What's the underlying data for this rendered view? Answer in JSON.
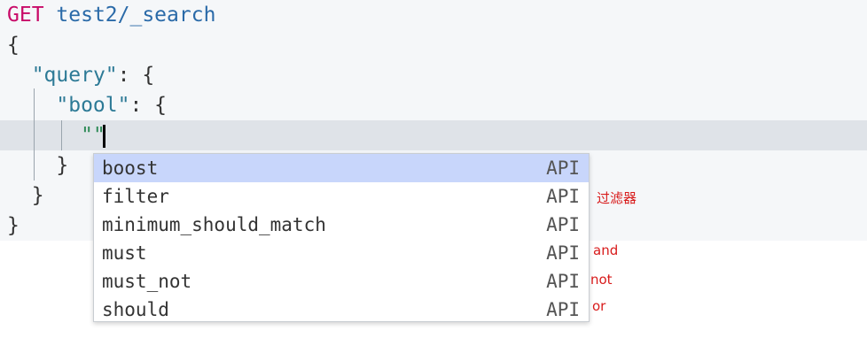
{
  "editor": {
    "method": "GET",
    "path": "test2/_search",
    "open_brace": "{",
    "query_key": "\"query\"",
    "query_rest": ": {",
    "bool_key": "\"bool\"",
    "bool_rest": ": {",
    "typed": "\"\"",
    "close_bool": "}",
    "close_query": "}",
    "close_root": "}"
  },
  "autocomplete": {
    "items": [
      {
        "label": "boost",
        "meta": "API",
        "selected": true
      },
      {
        "label": "filter",
        "meta": "API"
      },
      {
        "label": "minimum_should_match",
        "meta": "API"
      },
      {
        "label": "must",
        "meta": "API"
      },
      {
        "label": "must_not",
        "meta": "API"
      },
      {
        "label": "should",
        "meta": "API"
      }
    ]
  },
  "annotations": {
    "filter": "过滤器",
    "must": "and",
    "must_not": "not",
    "should": "or"
  },
  "colors": {
    "method": "#c80a68",
    "key": "#2d7a96",
    "selected": "#c8d6fb",
    "annotation": "#d81b1b"
  }
}
